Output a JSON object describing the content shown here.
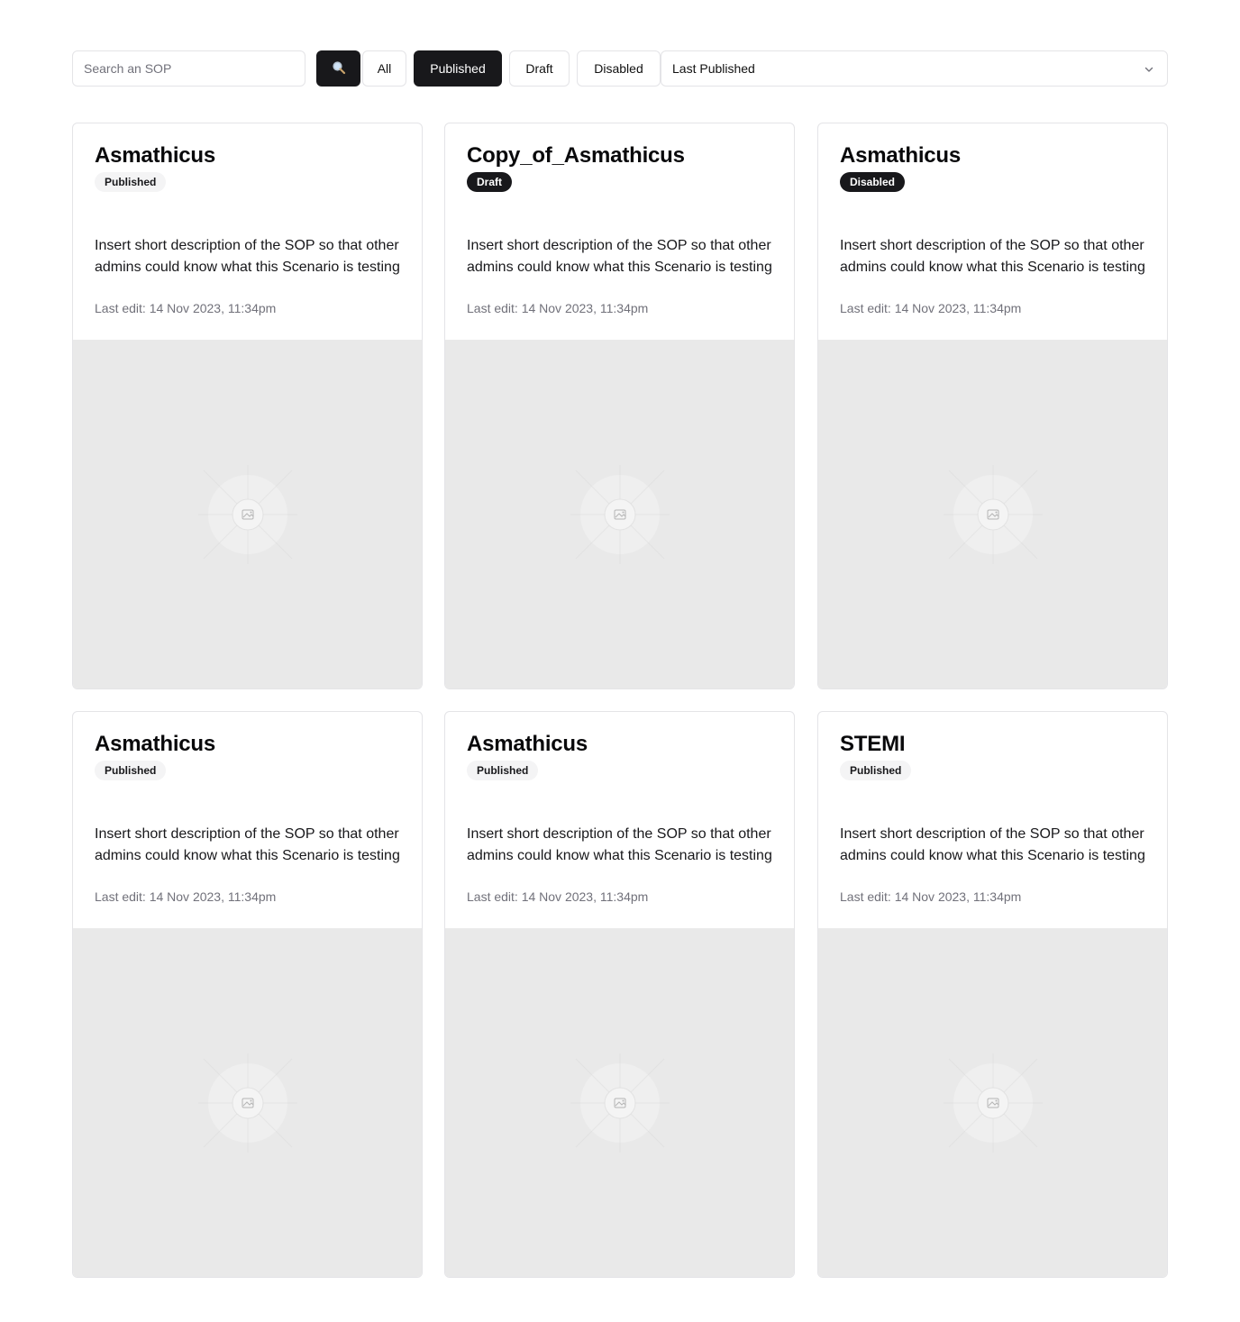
{
  "toolbar": {
    "search_placeholder": "Search an SOP",
    "filters": [
      {
        "label": "All",
        "active": false
      },
      {
        "label": "Published",
        "active": true
      },
      {
        "label": "Draft",
        "active": false
      },
      {
        "label": "Disabled",
        "active": false
      }
    ],
    "sort_selected": "Last Published"
  },
  "colors": {
    "primary_dark": "#18181b",
    "border": "#e4e4e7",
    "muted_text": "#71717a",
    "image_placeholder_bg": "#e9e9e9"
  },
  "cards": [
    {
      "title": "Asmathicus",
      "status": "Published",
      "status_style": "light",
      "description": "Insert short description of the SOP so that other admins could know what this Scenario is testing",
      "last_edit": "Last edit: 14 Nov 2023, 11:34pm",
      "image_icon": "image-placeholder-icon"
    },
    {
      "title": "Copy_of_Asmathicus",
      "status": "Draft",
      "status_style": "dark",
      "description": "Insert short description of the SOP so that other admins could know what this Scenario is testing",
      "last_edit": "Last edit: 14 Nov 2023, 11:34pm",
      "image_icon": "image-placeholder-icon"
    },
    {
      "title": "Asmathicus",
      "status": "Disabled",
      "status_style": "dark",
      "description": "Insert short description of the SOP so that other admins could know what this Scenario is testing",
      "last_edit": "Last edit: 14 Nov 2023, 11:34pm",
      "image_icon": "image-placeholder-icon"
    },
    {
      "title": "Asmathicus",
      "status": "Published",
      "status_style": "light",
      "description": "Insert short description of the SOP so that other admins could know what this Scenario is testing",
      "last_edit": "Last edit: 14 Nov 2023, 11:34pm",
      "image_icon": "image-placeholder-icon"
    },
    {
      "title": "Asmathicus",
      "status": "Published",
      "status_style": "light",
      "description": "Insert short description of the SOP so that other admins could know what this Scenario is testing",
      "last_edit": "Last edit: 14 Nov 2023, 11:34pm",
      "image_icon": "image-placeholder-icon"
    },
    {
      "title": "STEMI",
      "status": "Published",
      "status_style": "light",
      "description": "Insert short description of the SOP so that other admins could know what this Scenario is testing",
      "last_edit": "Last edit: 14 Nov 2023, 11:34pm",
      "image_icon": "image-placeholder-icon"
    }
  ]
}
